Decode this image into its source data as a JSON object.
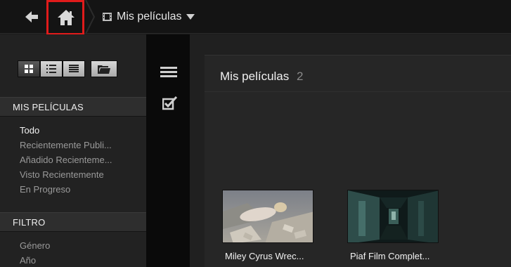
{
  "header": {
    "breadcrumb_label": "Mis películas"
  },
  "sidebar": {
    "section_movies": "MIS PELÍCULAS",
    "items": [
      {
        "label": "Todo"
      },
      {
        "label": "Recientemente Publi..."
      },
      {
        "label": "Añadido Recienteme..."
      },
      {
        "label": "Visto Recientemente"
      },
      {
        "label": "En Progreso"
      }
    ],
    "section_filter": "FILTRO",
    "filter_items": [
      {
        "label": "Género"
      },
      {
        "label": "Año"
      }
    ]
  },
  "main": {
    "title": "Mis películas",
    "count": "2",
    "movies": [
      {
        "title": "Miley Cyrus Wrec..."
      },
      {
        "title": "Piaf Film Complet..."
      }
    ]
  },
  "colors": {
    "highlight_box": "#e01b1b",
    "background": "#1c1c1c",
    "topbar": "#141414"
  },
  "icons": [
    "back-arrow-icon",
    "home-icon",
    "film-icon",
    "caret-down-icon",
    "grid-view-icon",
    "list-view-icon",
    "detail-list-view-icon",
    "folder-icon",
    "menu-icon",
    "checkbox-icon"
  ]
}
